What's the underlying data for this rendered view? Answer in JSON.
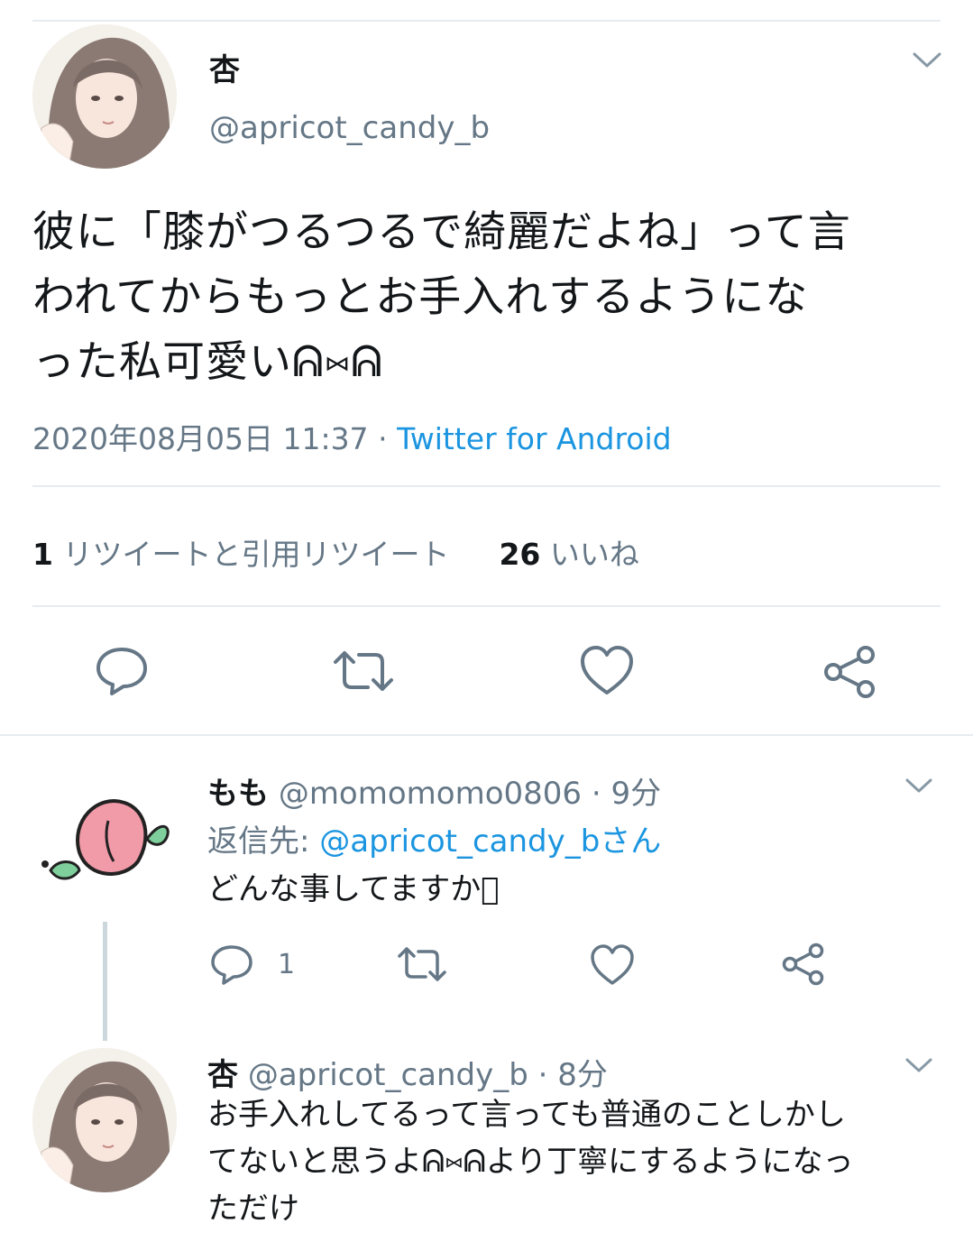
{
  "main_tweet": {
    "display_name": "杏",
    "handle": "@apricot_candy_b",
    "text_lines": [
      "彼に「膝がつるつるで綺麗だよね」って言",
      "われてからもっとお手入れするようにな",
      "った私可愛いᕱ⑅ᕱ"
    ],
    "timestamp": "2020年08月05日 11:37",
    "separator": "·",
    "source": "Twitter for Android",
    "retweet_count": "1",
    "retweet_label": "リツイートと引用リツイート",
    "like_count": "26",
    "like_label": "いいね"
  },
  "replies": [
    {
      "display_name": "もも",
      "handle": "@momomomo0806",
      "time": "· 9分",
      "reply_to_prefix": "返信先:",
      "reply_to_target": "@apricot_candy_bさん",
      "text_lines": [
        "どんな事してますか􀀀"
      ],
      "reply_count": "1"
    },
    {
      "display_name": "杏",
      "handle": "@apricot_candy_b",
      "time": "· 8分",
      "text_lines": [
        "お手入れしてるって言っても普通のことしかし",
        "てないと思うよᕱ⑅ᕱより丁寧にするようになっ",
        "ただけ"
      ]
    }
  ],
  "icons": {
    "reply": "reply-icon",
    "retweet": "retweet-icon",
    "like": "heart-icon",
    "share": "share-icon",
    "menu": "chevron-down-icon"
  },
  "colors": {
    "accent": "#1b95e0",
    "muted": "#657786",
    "text": "#14171a",
    "divider": "#e6ecf0"
  }
}
